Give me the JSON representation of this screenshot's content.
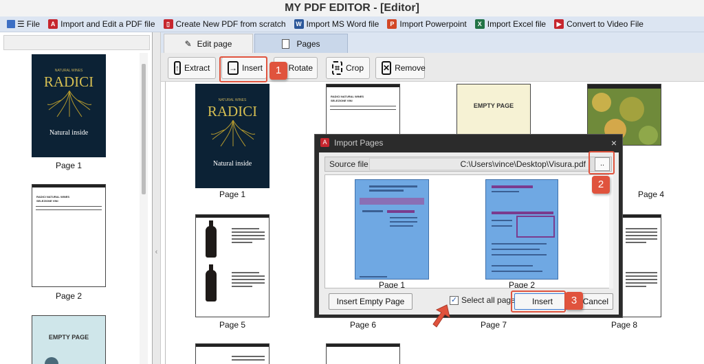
{
  "window": {
    "title": "MY PDF EDITOR - [Editor]"
  },
  "menu": {
    "file": "File",
    "items": [
      {
        "label": "Import and Edit a PDF file",
        "color": "#c6262e"
      },
      {
        "label": "Create New PDF from scratch",
        "color": "#c6262e"
      },
      {
        "label": "Import MS Word file",
        "color": "#2b579a"
      },
      {
        "label": "Import Powerpoint",
        "color": "#d24726"
      },
      {
        "label": "Import Excel file",
        "color": "#217346"
      },
      {
        "label": "Convert to Video File",
        "color": "#c6262e"
      }
    ]
  },
  "tabs": {
    "edit": "Edit page",
    "pages": "Pages"
  },
  "toolbar": {
    "extract": "Extract",
    "insert": "Insert",
    "rotate": "Rotate",
    "crop": "Crop",
    "remove": "Remove"
  },
  "sidebar": {
    "pages": [
      "Page 1",
      "Page 2"
    ]
  },
  "content": {
    "labels": [
      "Page 1",
      "Page 4",
      "Page 5",
      "Page 6",
      "Page 7",
      "Page 8"
    ],
    "radici": {
      "brand": "NATURAL WINES",
      "logo": "RADICI",
      "tagline": "Natural inside"
    },
    "doc": {
      "heading1": "RADICI NATURAL WINES",
      "heading2": "SELEZIONE VINI"
    },
    "empty_page": "EMPTY PAGE"
  },
  "dialog": {
    "title": "Import Pages",
    "source_label": "Source file",
    "source_path": "C:\\Users\\vince\\Desktop\\Visura.pdf",
    "browse": "..",
    "pages": [
      "Page 1",
      "Page 2"
    ],
    "insert_empty": "Insert Empty Page",
    "select_all": "Select all pages",
    "select_all_checked": true,
    "insert": "Insert",
    "cancel": "Cancel"
  },
  "callouts": [
    "1",
    "2",
    "3"
  ],
  "accent": "#e0533d"
}
